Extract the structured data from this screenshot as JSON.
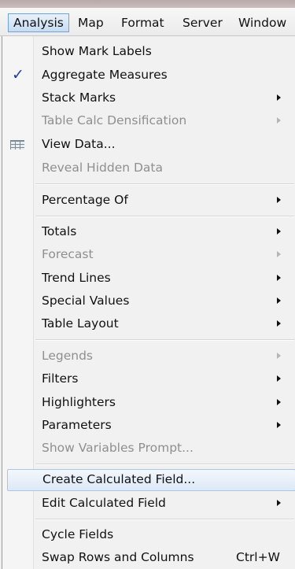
{
  "menubar": {
    "items": [
      "Analysis",
      "Map",
      "Format",
      "Server",
      "Window"
    ]
  },
  "menu": {
    "items": [
      {
        "label": "Show Mark Labels",
        "enabled": true
      },
      {
        "label": "Aggregate Measures",
        "enabled": true,
        "checked": true
      },
      {
        "label": "Stack Marks",
        "enabled": true,
        "submenu": true
      },
      {
        "label": "Table Calc Densification",
        "enabled": false,
        "submenu": true
      },
      {
        "label": "View Data...",
        "enabled": true,
        "icon": "table-grid-icon"
      },
      {
        "label": "Reveal Hidden Data",
        "enabled": false
      },
      {
        "label": "Percentage Of",
        "enabled": true,
        "submenu": true
      },
      {
        "label": "Totals",
        "enabled": true,
        "submenu": true
      },
      {
        "label": "Forecast",
        "enabled": false,
        "submenu": true
      },
      {
        "label": "Trend Lines",
        "enabled": true,
        "submenu": true
      },
      {
        "label": "Special Values",
        "enabled": true,
        "submenu": true
      },
      {
        "label": "Table Layout",
        "enabled": true,
        "submenu": true
      },
      {
        "label": "Legends",
        "enabled": false,
        "submenu": true
      },
      {
        "label": "Filters",
        "enabled": true,
        "submenu": true
      },
      {
        "label": "Highlighters",
        "enabled": true,
        "submenu": true
      },
      {
        "label": "Parameters",
        "enabled": true,
        "submenu": true
      },
      {
        "label": "Show Variables Prompt...",
        "enabled": false
      },
      {
        "label": "Create Calculated Field...",
        "enabled": true,
        "highlighted": true
      },
      {
        "label": "Edit Calculated Field",
        "enabled": true,
        "submenu": true
      },
      {
        "label": "Cycle Fields",
        "enabled": true
      },
      {
        "label": "Swap Rows and Columns",
        "enabled": true,
        "shortcut": "Ctrl+W"
      }
    ]
  },
  "colors": {
    "check": "#1a3faa",
    "highlight_border": "#a9c6e8",
    "disabled_text": "#8f8f8f"
  }
}
